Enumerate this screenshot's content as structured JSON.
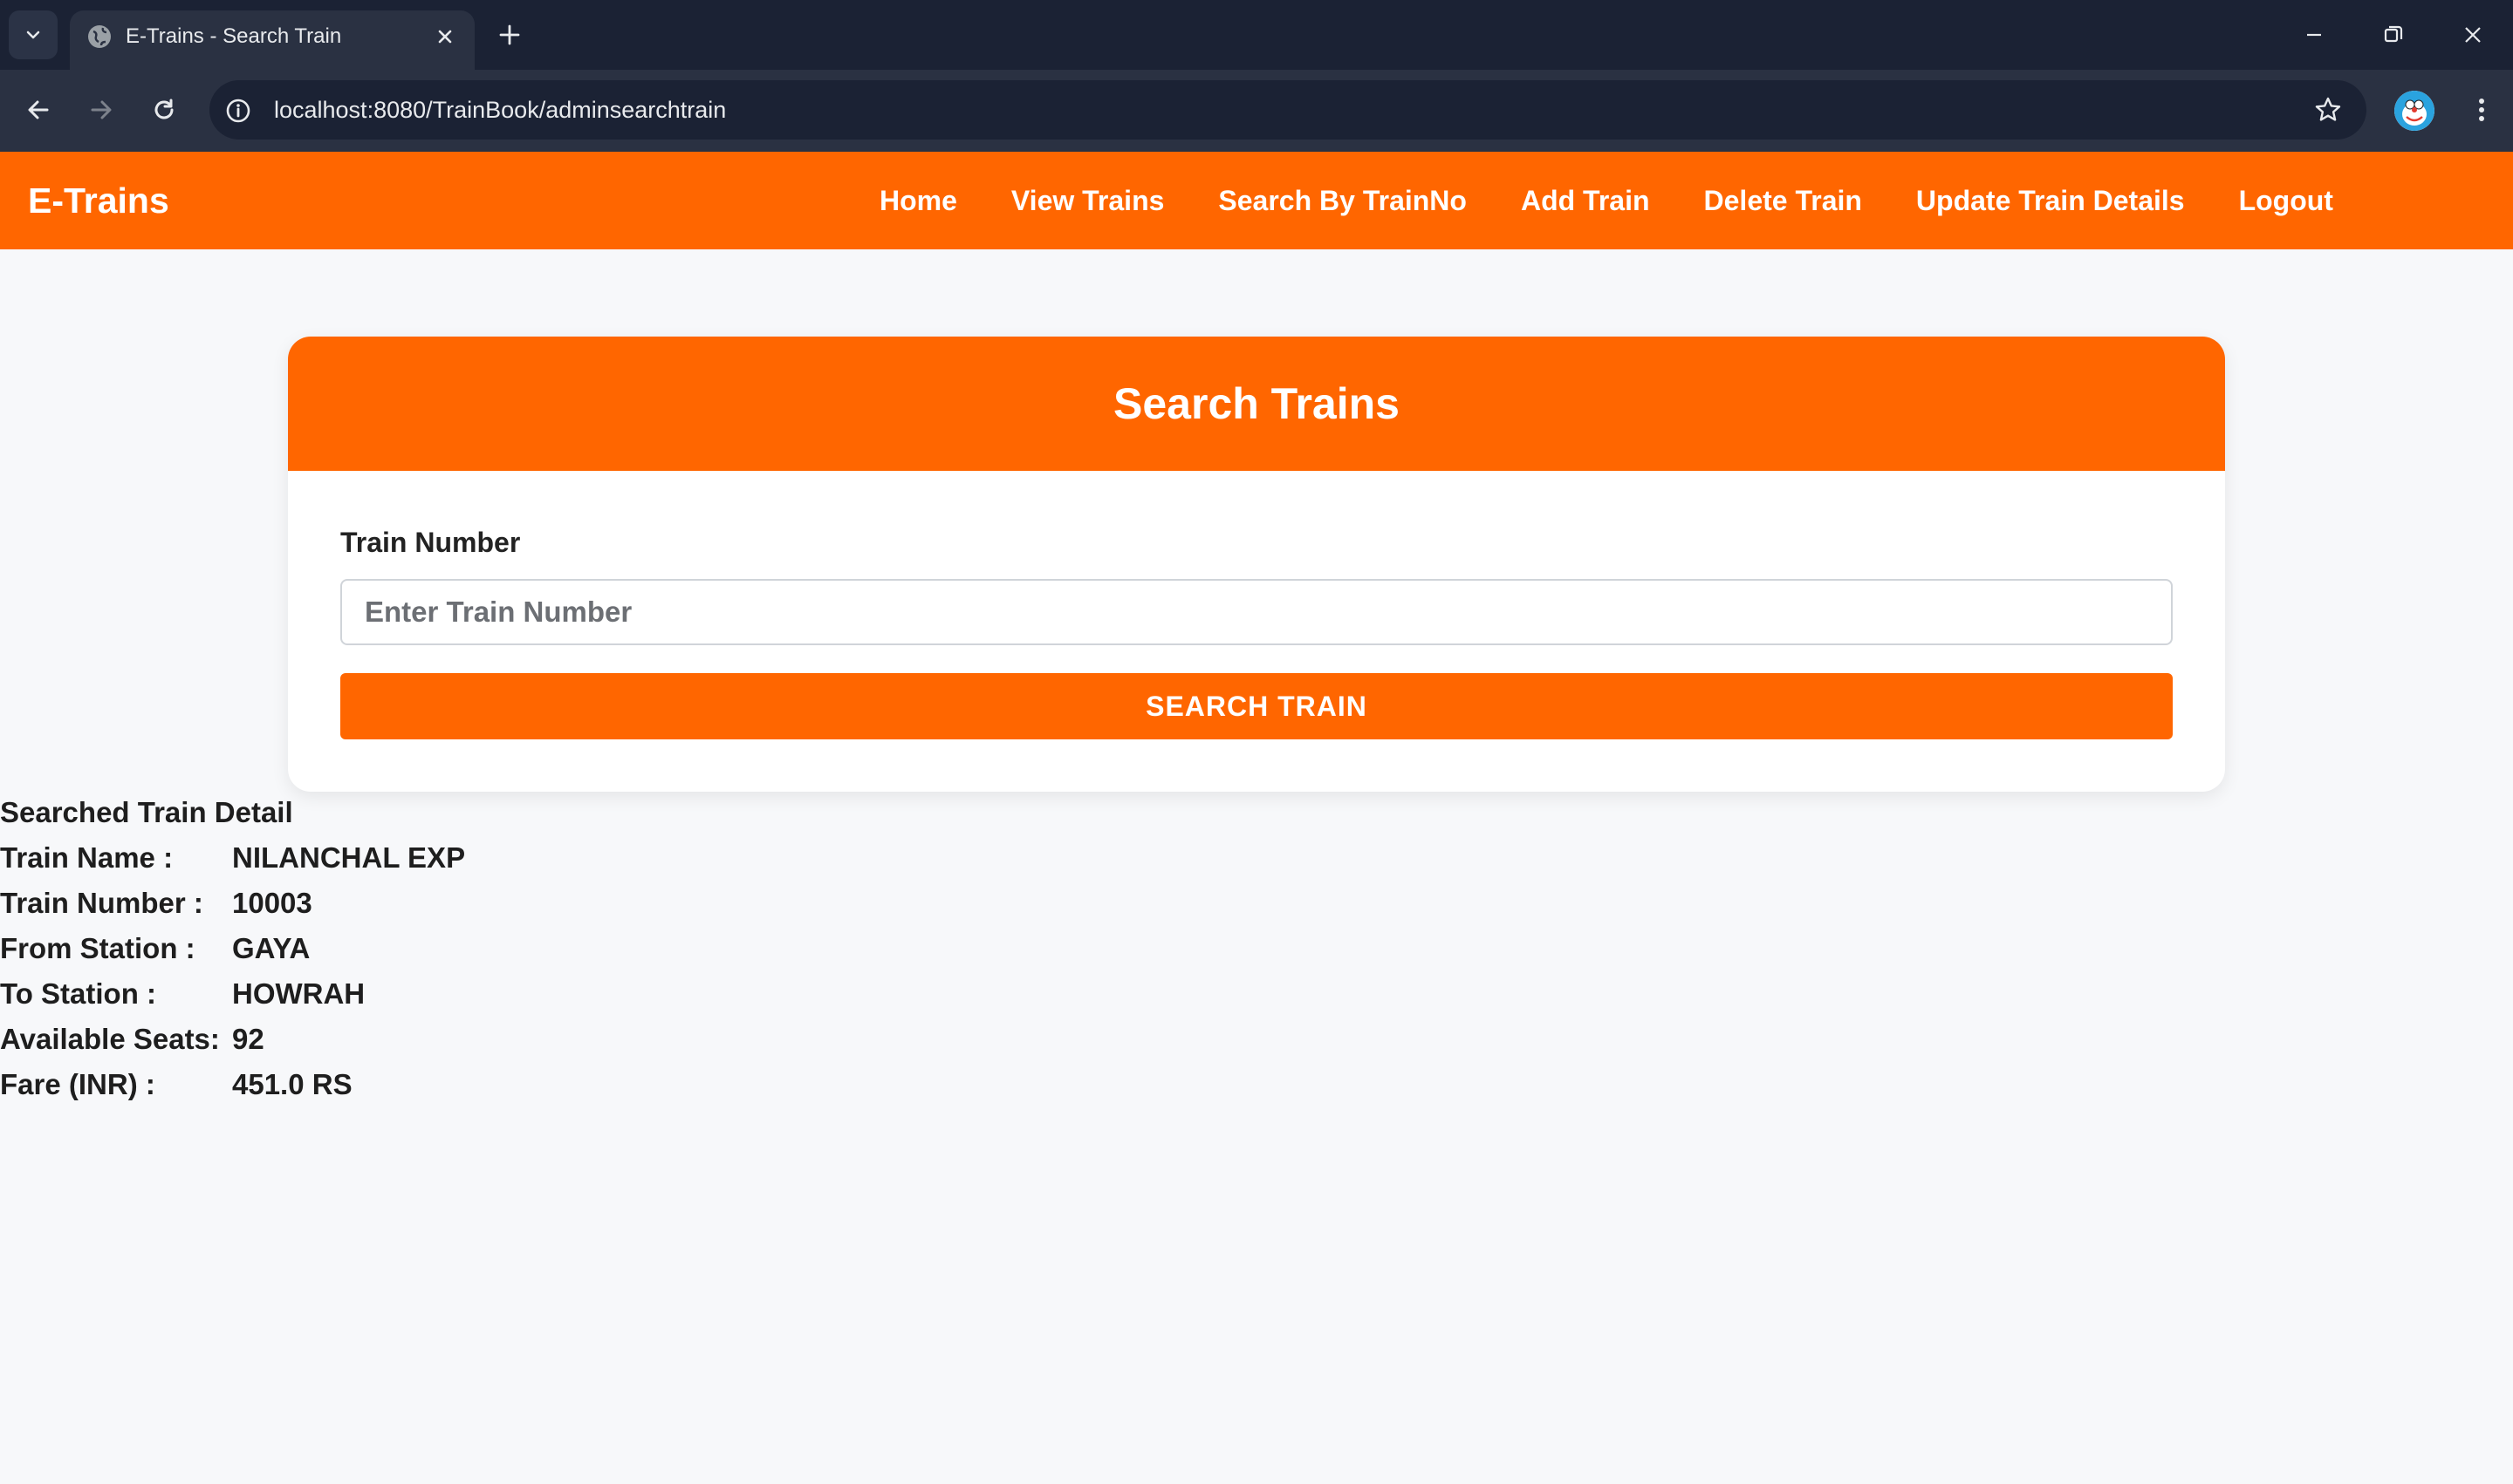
{
  "browser": {
    "tab_title": "E-Trains - Search Train",
    "url_host": "localhost",
    "url_rest": ":8080/TrainBook/adminsearchtrain",
    "icons": [
      "tab-search-icon",
      "globe-icon",
      "close-icon",
      "plus-icon",
      "minimize-icon",
      "restore-icon",
      "window-close-icon",
      "back-arrow-icon",
      "forward-arrow-icon",
      "reload-icon",
      "info-icon",
      "star-icon",
      "profile-avatar-icon",
      "kebab-menu-icon"
    ]
  },
  "navbar": {
    "brand": "E-Trains",
    "links": [
      "Home",
      "View Trains",
      "Search By TrainNo",
      "Add Train",
      "Delete Train",
      "Update Train Details",
      "Logout"
    ],
    "color": "#ff6600"
  },
  "search_card": {
    "title": "Search Trains",
    "field_label": "Train Number",
    "placeholder": "Enter Train Number",
    "button_label": "SEARCH TRAIN"
  },
  "result": {
    "heading": "Searched Train Detail",
    "rows": [
      {
        "key": "Train Name :",
        "value": "NILANCHAL EXP"
      },
      {
        "key": "Train Number :",
        "value": "10003"
      },
      {
        "key": "From Station :",
        "value": "GAYA"
      },
      {
        "key": "To Station :",
        "value": "HOWRAH"
      },
      {
        "key": "Available Seats:",
        "value": "92"
      },
      {
        "key": "Fare (INR) :",
        "value": "451.0 RS"
      }
    ]
  }
}
